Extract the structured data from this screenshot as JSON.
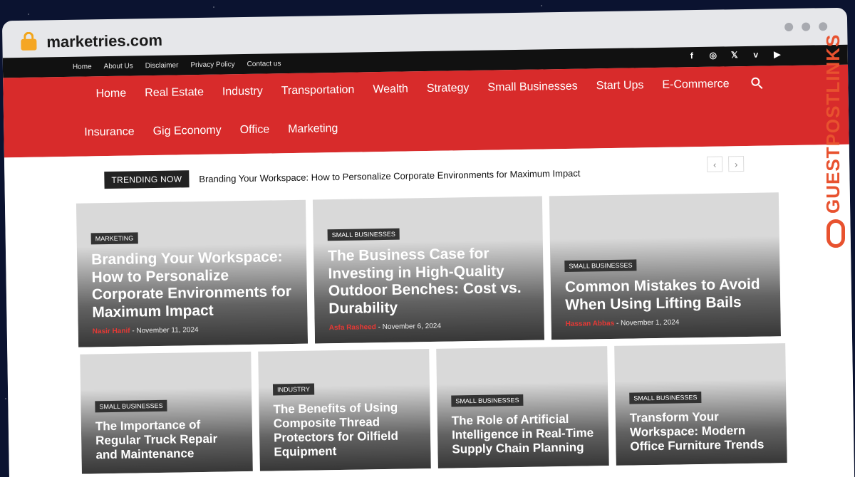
{
  "browser": {
    "url": "marketries.com"
  },
  "topbar": {
    "links": [
      "Home",
      "About Us",
      "Disclaimer",
      "Privacy Policy",
      "Contact us"
    ]
  },
  "socials": {
    "icons": [
      "facebook-icon",
      "instagram-icon",
      "x-icon",
      "vimeo-icon",
      "youtube-icon"
    ],
    "glyphs": [
      "f",
      "◎",
      "𝕏",
      "v",
      "▶"
    ]
  },
  "nav": {
    "row1": [
      "Home",
      "Real Estate",
      "Industry",
      "Transportation",
      "Wealth",
      "Strategy",
      "Small Businesses",
      "Start Ups",
      "E-Commerce"
    ],
    "row2": [
      "Insurance",
      "Gig Economy",
      "Office",
      "Marketing"
    ]
  },
  "trending": {
    "label": "TRENDING NOW",
    "title": "Branding Your Workspace: How to Personalize Corporate Environments for Maximum Impact",
    "prev": "‹",
    "next": "›"
  },
  "featured": [
    {
      "category": "MARKETING",
      "title": "Branding Your Workspace: How to Personalize Corporate Environments for Maximum Impact",
      "author": "Nasir Hanif",
      "date": "November 11, 2024"
    },
    {
      "category": "SMALL BUSINESSES",
      "title": "The Business Case for Investing in High-Quality Outdoor Benches: Cost vs. Durability",
      "author": "Asfa Rasheed",
      "date": "November 6, 2024"
    },
    {
      "category": "SMALL BUSINESSES",
      "title": "Common Mistakes to Avoid When Using Lifting Bails",
      "author": "Hassan Abbas",
      "date": "November 1, 2024"
    }
  ],
  "secondary": [
    {
      "category": "SMALL BUSINESSES",
      "title": "The Importance of Regular Truck Repair and Maintenance"
    },
    {
      "category": "INDUSTRY",
      "title": "The Benefits of Using Composite Thread Protectors for Oilfield Equipment"
    },
    {
      "category": "SMALL BUSINESSES",
      "title": "The Role of Artificial Intelligence in Real-Time Supply Chain Planning"
    },
    {
      "category": "SMALL BUSINESSES",
      "title": "Transform Your Workspace: Modern Office Furniture Trends"
    }
  ],
  "watermark": {
    "text": "GUESTPOSTLINKS",
    "color": "#e8522f"
  },
  "colors": {
    "nav_red": "#d82b2b",
    "author_red": "#e53935",
    "topbar": "#111111"
  }
}
